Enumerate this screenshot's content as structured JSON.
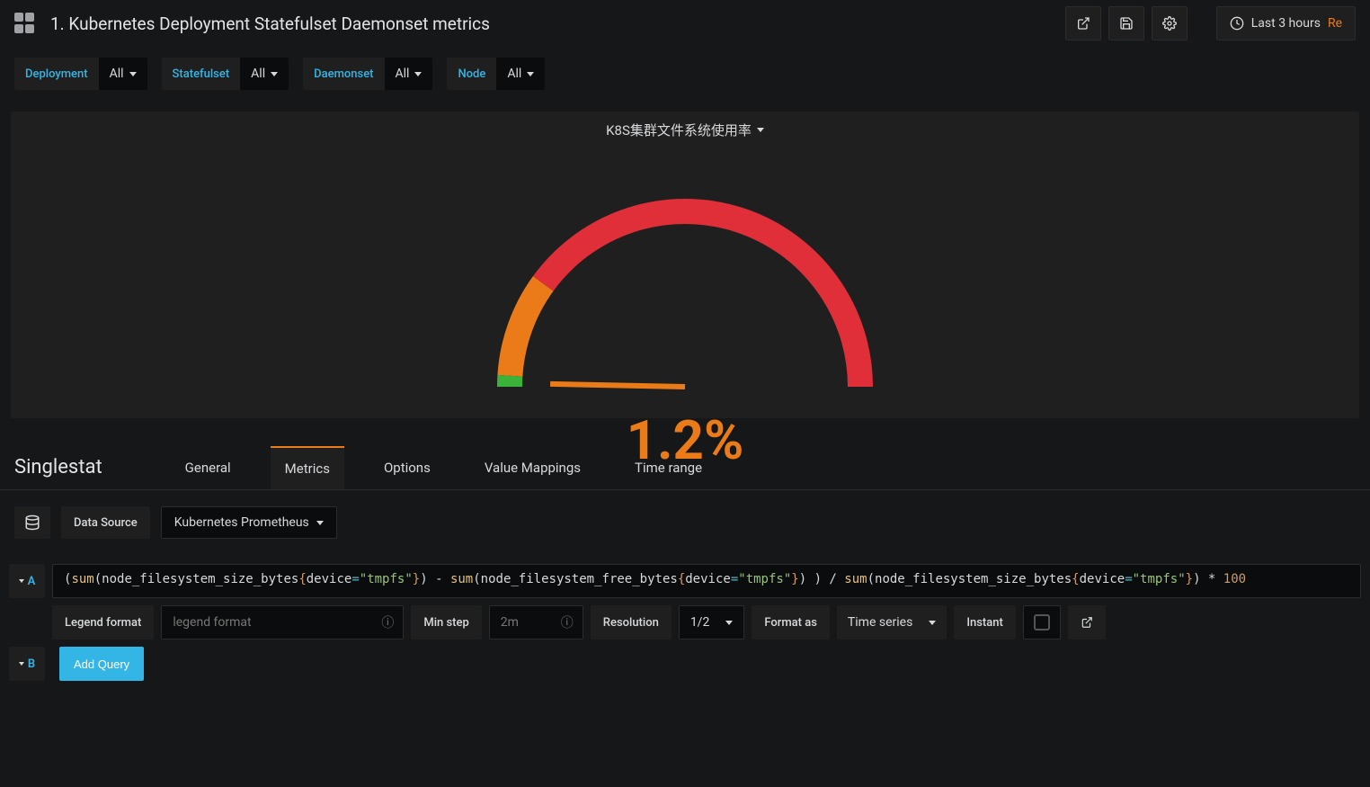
{
  "header": {
    "title": "1. Kubernetes Deployment Statefulset Daemonset metrics",
    "time_label": "Last 3 hours",
    "time_suffix": "Re"
  },
  "filters": [
    {
      "label": "Deployment",
      "value": "All"
    },
    {
      "label": "Statefulset",
      "value": "All"
    },
    {
      "label": "Daemonset",
      "value": "All"
    },
    {
      "label": "Node",
      "value": "All"
    }
  ],
  "panel": {
    "title": "K8S集群文件系统使用率",
    "value_text": "1.2%"
  },
  "chart_data": {
    "type": "gauge",
    "title": "K8S集群文件系统使用率",
    "value": 1.2,
    "unit": "%",
    "min": 0,
    "max": 100,
    "thresholds": [
      {
        "from": 0,
        "to": 2,
        "color": "#3bb33b"
      },
      {
        "from": 2,
        "to": 20,
        "color": "#eb7b18"
      },
      {
        "from": 20,
        "to": 100,
        "color": "#e02f38"
      }
    ]
  },
  "editor": {
    "name": "Singlestat",
    "tabs": [
      "General",
      "Metrics",
      "Options",
      "Value Mappings",
      "Time range"
    ],
    "active_tab": "Metrics",
    "datasource_label": "Data Source",
    "datasource_value": "Kubernetes Prometheus"
  },
  "query": {
    "letter_a": "A",
    "letter_b": "B",
    "expr_parts": {
      "p1": "(",
      "fn1": "sum",
      "p2": "(node_filesystem_size_bytes",
      "b1": "{",
      "k1": "device",
      "v1": "\"tmpfs\"",
      "b2": "}",
      "p3": ") - ",
      "fn2": "sum",
      "p4": "(node_filesystem_free_bytes",
      "p5": ") ) / ",
      "fn3": "sum",
      "p6": "(node_filesystem_size_bytes",
      "p7": ") * ",
      "num": "100"
    },
    "legend_label": "Legend format",
    "legend_placeholder": "legend format",
    "minstep_label": "Min step",
    "minstep_placeholder": "2m",
    "resolution_label": "Resolution",
    "resolution_value": "1/2",
    "format_label": "Format as",
    "format_value": "Time series",
    "instant_label": "Instant",
    "add_query_label": "Add Query"
  }
}
